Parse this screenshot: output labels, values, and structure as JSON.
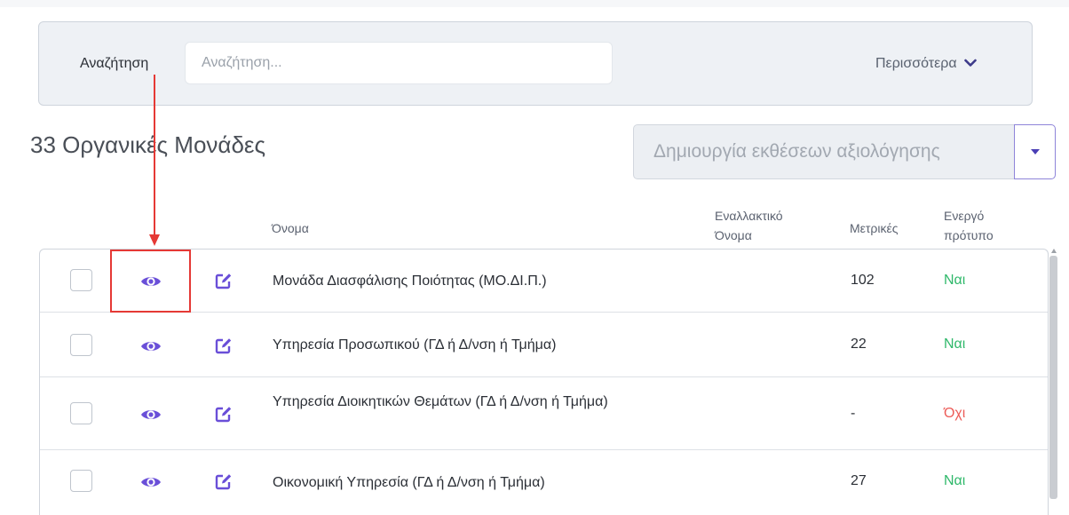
{
  "search": {
    "label": "Αναζήτηση",
    "placeholder": "Αναζήτηση...",
    "value": "",
    "more_label": "Περισσότερα"
  },
  "page": {
    "title": "33 Οργανικές Μονάδες"
  },
  "report_dropdown": {
    "label": "Δημιουργία εκθέσεων αξιολόγησης"
  },
  "table": {
    "headers": {
      "name": "Όνομα",
      "alt_name": "Εναλλακτικό Όνομα",
      "metrics": "Μετρικές",
      "active_template": "Ενεργό πρότυπο"
    },
    "rows": [
      {
        "name": "Μονάδα Διασφάλισης Ποιότητας (ΜΟ.ΔΙ.Π.)",
        "alt_name": "",
        "metrics": "102",
        "active": "Ναι",
        "active_color": "#2fb86a"
      },
      {
        "name": "Υπηρεσία Προσωπικού (ΓΔ ή Δ/νση ή Τμήμα)",
        "alt_name": "",
        "metrics": "22",
        "active": "Ναι",
        "active_color": "#2fb86a"
      },
      {
        "name": "Υπηρεσία Διοικητικών Θεμάτων (ΓΔ ή Δ/νση ή Τμήμα)",
        "alt_name": "",
        "metrics": "-",
        "active": "Όχι",
        "active_color": "#ec5b57"
      },
      {
        "name": "Οικονομική Υπηρεσία (ΓΔ ή Δ/νση ή Τμήμα)",
        "alt_name": "",
        "metrics": "27",
        "active": "Ναι",
        "active_color": "#2fb86a"
      }
    ]
  },
  "icons": {
    "view": "eye-icon",
    "edit": "edit-icon",
    "more": "chevron-down-icon",
    "dropdown": "caret-down-icon"
  },
  "colors": {
    "accent": "#6a4fd8",
    "highlight": "#e53935",
    "yes": "#2fb86a",
    "no": "#ec5b57"
  }
}
